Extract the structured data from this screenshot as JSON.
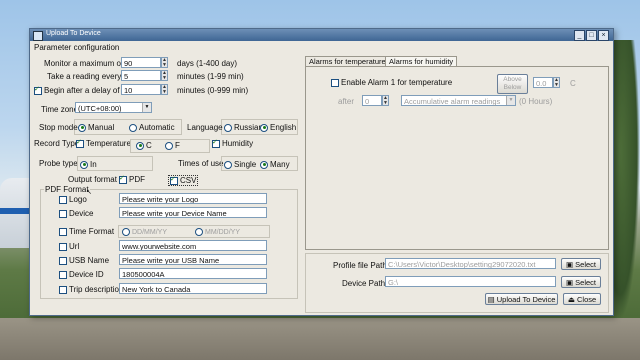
{
  "window": {
    "title": "Upload To Device",
    "section": "Parameter configuration",
    "controls": [
      "_",
      "□",
      "×"
    ]
  },
  "params": {
    "monitor_label": "Monitor a maximum of",
    "monitor_value": "90",
    "monitor_unit": "days (1-400 day)",
    "reading_label": "Take a reading every",
    "reading_value": "5",
    "reading_unit": "minutes (1-99 min)",
    "delay_label": "Begin after a delay of",
    "delay_value": "10",
    "delay_unit": "minutes (0-999 min)",
    "delay_checked": true,
    "timezone_label": "Time zone",
    "timezone_value": "(UTC+08:00)"
  },
  "stop_mode": {
    "label": "Stop mode",
    "options": [
      "Manual",
      "Automatic"
    ],
    "selected": "Manual"
  },
  "language": {
    "label": "Language",
    "options": [
      "Russian",
      "English"
    ],
    "selected": "English"
  },
  "record_type": {
    "label": "Record Type",
    "temperature": "Temperature",
    "temperature_checked": true,
    "unit_c": "C",
    "unit_f": "F",
    "unit_selected": "C",
    "humidity": "Humidity",
    "humidity_checked": true
  },
  "probe_type": {
    "label": "Probe type",
    "option": "In",
    "selected": true
  },
  "times_of_use": {
    "label": "Times of use",
    "options": [
      "Single",
      "Many"
    ],
    "selected": "Many"
  },
  "output_format": {
    "label": "Output format",
    "pdf": "PDF",
    "pdf_checked": true,
    "csv": "CSV",
    "csv_checked": true
  },
  "pdf_format": {
    "title": "PDF Format",
    "logo_label": "Logo",
    "logo_value": "Please write your Logo",
    "device_label": "Device",
    "device_value": "Please write your Device Name",
    "time_label": "Time Format",
    "time_opt1": "DD/MM/YY",
    "time_opt2": "MM/DD/YY",
    "url_label": "Url",
    "url_value": "www.yourwebsite.com",
    "usb_label": "USB Name",
    "usb_value": "Please write your USB Name",
    "device_id_label": "Device ID",
    "device_id_value": "180500004A",
    "trip_label": "Trip description",
    "trip_value": "New York to Canada"
  },
  "alarm_tabs": {
    "tab1": "Alarms for temperature",
    "tab2": "Alarms for humidity",
    "active": "tab1"
  },
  "alarm": {
    "enable_label": "Enable Alarm 1 for temperature",
    "above_label": "Above",
    "below_label": "Below",
    "threshold_value": "0.0",
    "unit": "C",
    "after_label": "after",
    "after_value": "0",
    "mode_value": "Accumulative alarm readings",
    "hours_text": "(0 Hours)"
  },
  "paths": {
    "profile_label": "Profile file Path",
    "profile_value": "C:\\Users\\Victor\\Desktop\\setting29072020.txt",
    "device_label": "Device Path",
    "device_value": "G:\\",
    "select_label": "Select"
  },
  "actions": {
    "upload_label": "Upload To Device",
    "close_label": "Close"
  },
  "colors": {
    "title_bar": "#3f6694",
    "window_bg": "#ece9e1",
    "check_mark": "#1a7a1a"
  }
}
